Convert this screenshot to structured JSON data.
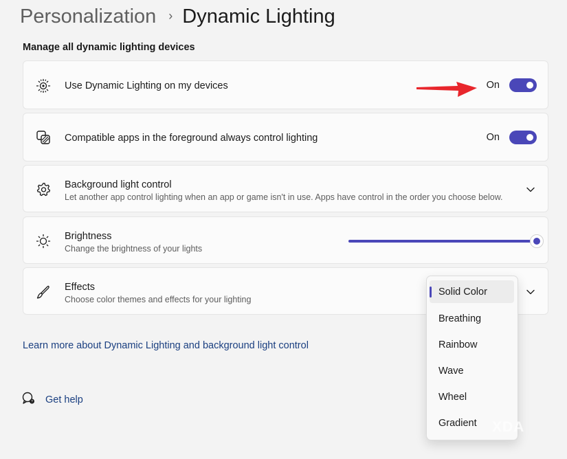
{
  "breadcrumb": {
    "parent": "Personalization",
    "separator": "›",
    "current": "Dynamic Lighting"
  },
  "section_title": "Manage all dynamic lighting devices",
  "settings": {
    "use_dynamic_lighting": {
      "icon": "dynamic-lighting-icon",
      "title": "Use Dynamic Lighting on my devices",
      "state_label": "On",
      "enabled": true
    },
    "compatible_apps": {
      "icon": "apps-layers-icon",
      "title": "Compatible apps in the foreground always control lighting",
      "state_label": "On",
      "enabled": true
    },
    "background_light_control": {
      "icon": "gear-icon",
      "title": "Background light control",
      "description": "Let another app control lighting when an app or game isn't in use. Apps have control in the order you choose below."
    },
    "brightness": {
      "icon": "sun-icon",
      "title": "Brightness",
      "description": "Change the brightness of your lights",
      "value_fraction": 1.0
    },
    "effects": {
      "icon": "brush-icon",
      "title": "Effects",
      "description": "Choose color themes and effects for your lighting",
      "selected": "Solid Color",
      "options": [
        "Solid Color",
        "Breathing",
        "Rainbow",
        "Wave",
        "Wheel",
        "Gradient"
      ]
    }
  },
  "links": {
    "learn_more": "Learn more about Dynamic Lighting and background light control",
    "get_help": "Get help"
  },
  "watermark": "XDA",
  "colors": {
    "accent": "#4a47b8",
    "arrow": "#e8262c",
    "link": "#1a3f80",
    "background": "#f3f3f3"
  }
}
